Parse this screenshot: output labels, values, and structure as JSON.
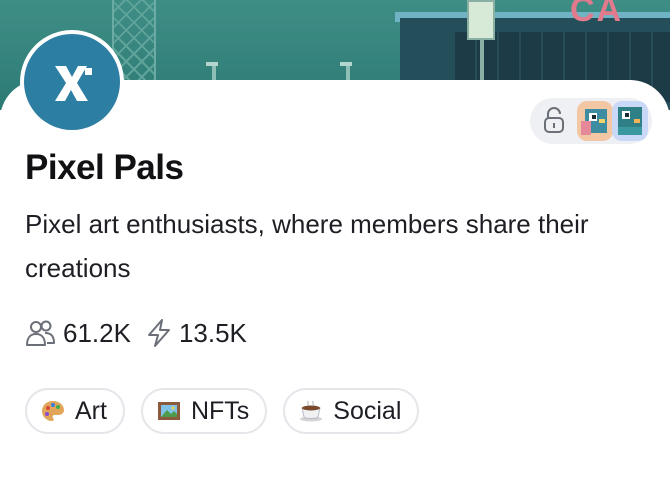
{
  "community": {
    "name": "Pixel Pals",
    "description": "Pixel art enthusiasts, where members share their creations",
    "brand_color": "#2d7ea3"
  },
  "banner": {
    "sign_text": "CA"
  },
  "stats": {
    "members": {
      "icon": "users-icon",
      "value": "61.2K"
    },
    "activity": {
      "icon": "lightning-icon",
      "value": "13.5K"
    }
  },
  "tags": [
    {
      "icon": "palette-icon",
      "label": "Art"
    },
    {
      "icon": "framed-picture-icon",
      "label": "NFTs"
    },
    {
      "icon": "coffee-icon",
      "label": "Social"
    }
  ],
  "access": {
    "icon": "lock-icon"
  }
}
